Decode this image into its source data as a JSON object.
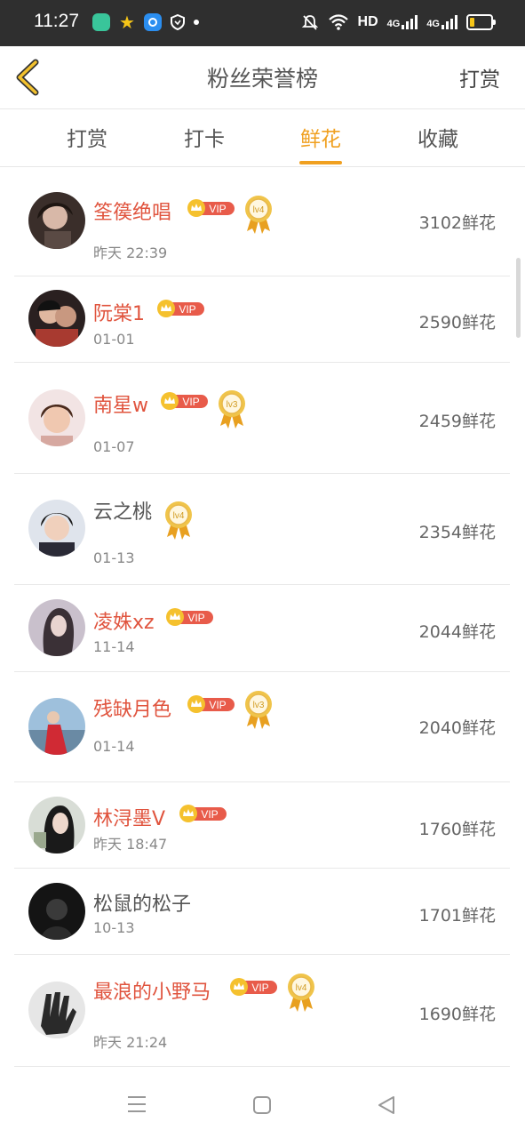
{
  "status_bar": {
    "time": "11:27",
    "network_label": "HD",
    "signal_1": "4G",
    "signal_2": "4G"
  },
  "nav": {
    "title": "粉丝荣誉榜",
    "right_action": "打赏",
    "back_icon": "chevron-left-icon"
  },
  "tabs": [
    {
      "label": "打赏",
      "active": false
    },
    {
      "label": "打卡",
      "active": false
    },
    {
      "label": "鲜花",
      "active": true
    },
    {
      "label": "收藏",
      "active": false
    }
  ],
  "vip_label": "VIP",
  "colors": {
    "accent": "#f0a020",
    "vip_name": "#e0543e",
    "vip_badge": "#e85b4a",
    "medal_gold": "#e8b84a"
  },
  "rows": [
    {
      "name": "筌篌绝唱",
      "date": "昨天 22:39",
      "score": "3102鲜花",
      "vip": true,
      "medal": "lv4"
    },
    {
      "name": "阮棠1",
      "date": "01-01",
      "score": "2590鲜花",
      "vip": true,
      "medal": ""
    },
    {
      "name": "南星w",
      "date": "01-07",
      "score": "2459鲜花",
      "vip": true,
      "medal": "lv3"
    },
    {
      "name": "云之桃",
      "date": "01-13",
      "score": "2354鲜花",
      "vip": false,
      "medal": "lv4"
    },
    {
      "name": "凌姝xz",
      "date": "11-14",
      "score": "2044鲜花",
      "vip": true,
      "medal": ""
    },
    {
      "name": "残缺月色",
      "date": "01-14",
      "score": "2040鲜花",
      "vip": true,
      "medal": "lv3"
    },
    {
      "name": "林浔墨V",
      "date": "昨天 18:47",
      "score": "1760鲜花",
      "vip": true,
      "medal": ""
    },
    {
      "name": "松鼠的松子",
      "date": "10-13",
      "score": "1701鲜花",
      "vip": false,
      "medal": ""
    },
    {
      "name": "最浪的小野马",
      "date": "昨天 21:24",
      "score": "1690鲜花",
      "vip": true,
      "medal": "lv4"
    }
  ],
  "system_nav": [
    "menu-icon",
    "home-square-icon",
    "back-triangle-icon"
  ]
}
